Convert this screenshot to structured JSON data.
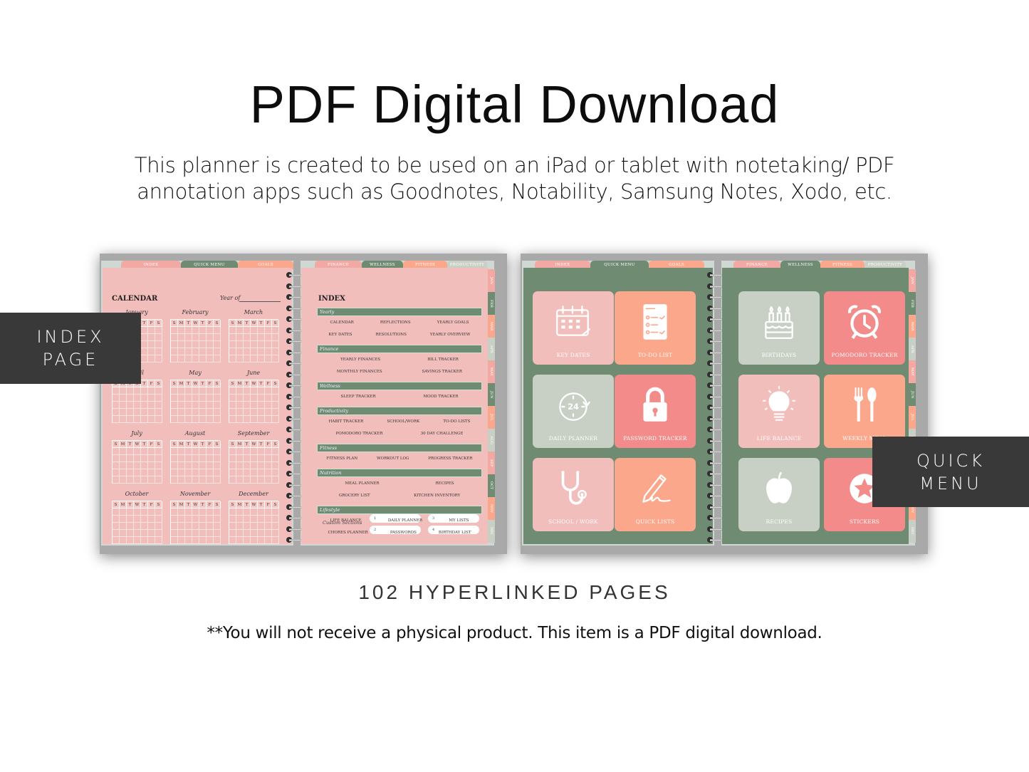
{
  "header": {
    "title": "PDF Digital Download",
    "subtitle_line1": "This planner is created to be used on an iPad or tablet with notetaking/ PDF",
    "subtitle_line2": "annotation apps such as Goodnotes, Notability, Samsung Notes, Xodo, etc."
  },
  "overlays": {
    "index_line1": "INDEX",
    "index_line2": "PAGE",
    "quick_line1": "QUICK",
    "quick_line2": "MENU"
  },
  "footer": {
    "pages_count": "102 HYPERLINKED PAGES",
    "disclaimer": "**You will not receive a physical product. This item is a PDF digital download."
  },
  "colors": {
    "pink": "#f2bebb",
    "green": "#6f8c73",
    "salmon": "#fba78c",
    "sage": "#c8cfc5",
    "rose": "#f28b89",
    "overlay": "#3a3939"
  },
  "top_tabs_left": [
    {
      "label": "INDEX",
      "color": "pink"
    },
    {
      "label": "QUICK MENU",
      "color": "green"
    },
    {
      "label": "GOALS",
      "color": "salmon"
    }
  ],
  "top_tabs_right": [
    {
      "label": "FINANCE",
      "color": "pink"
    },
    {
      "label": "WELLNESS",
      "color": "green"
    },
    {
      "label": "FITNESS",
      "color": "salmon"
    },
    {
      "label": "PRODUCTIVITY",
      "color": "sage"
    }
  ],
  "month_tabs": [
    {
      "label": "JAN",
      "color": "pink"
    },
    {
      "label": "FEB",
      "color": "green"
    },
    {
      "label": "MAR",
      "color": "salmon"
    },
    {
      "label": "APR",
      "color": "sage"
    },
    {
      "label": "MAY",
      "color": "pink"
    },
    {
      "label": "JUN",
      "color": "green"
    },
    {
      "label": "JUL",
      "color": "salmon"
    },
    {
      "label": "AUG",
      "color": "sage"
    },
    {
      "label": "SEP",
      "color": "pink"
    },
    {
      "label": "OCT",
      "color": "green"
    },
    {
      "label": "NOV",
      "color": "salmon"
    },
    {
      "label": "DEC",
      "color": "sage"
    }
  ],
  "calendar": {
    "title": "CALENDAR",
    "year_of": "Year of",
    "weekdays": [
      "S",
      "M",
      "T",
      "W",
      "T",
      "F",
      "S"
    ],
    "months": [
      "January",
      "February",
      "March",
      "April",
      "May",
      "June",
      "July",
      "August",
      "September",
      "October",
      "November",
      "December"
    ]
  },
  "index": {
    "title": "INDEX",
    "sections": [
      {
        "name": "Yearly",
        "rows": [
          [
            "CALENDAR",
            "REFLECTIONS",
            "YEARLY GOALS"
          ],
          [
            "KEY DATES",
            "RESOLUTIONS",
            "YEARLY OVERVIEW"
          ]
        ]
      },
      {
        "name": "Finance",
        "rows": [
          [
            "YEARLY FINANCES",
            "BILL TRACKER"
          ],
          [
            "MONTHLY FINANCES",
            "SAVINGS TRACKER"
          ]
        ]
      },
      {
        "name": "Wellness",
        "rows": [
          [
            "SLEEP TRACKER",
            "MOOD TRACKER"
          ]
        ]
      },
      {
        "name": "Productivity",
        "rows": [
          [
            "HABIT TRACKER",
            "SCHOOL/WORK",
            "TO-DO LISTS"
          ],
          [
            "POMODORO TRACKER",
            "30 DAY CHALLENGE"
          ]
        ]
      },
      {
        "name": "Fitness",
        "rows": [
          [
            "FITNESS PLAN",
            "WORKOUT LOG",
            "PROGRESS TRACKER"
          ]
        ]
      },
      {
        "name": "Nutrition",
        "rows": [
          [
            "MEAL PLANNER",
            "RECIPES"
          ],
          [
            "GROCERY LIST",
            "KITCHEN INVENTORY"
          ]
        ]
      },
      {
        "name": "Lifestyle",
        "rows": [
          [
            "LIFE BALANCE",
            "DAILY PLANNER",
            "MY LISTS"
          ],
          [
            "CHORES PLANNER",
            "PASSWORDS",
            "BIRTHDAY LIST"
          ]
        ]
      }
    ],
    "custom_label": "Custom Sections",
    "custom_slots": [
      "1",
      "2",
      "3",
      "4"
    ]
  },
  "quick_menu": {
    "title": "QUICK MENU",
    "tiles": [
      {
        "label": "KEY DATES",
        "icon": "calendar-icon",
        "color": "pink"
      },
      {
        "label": "TO-DO LIST",
        "icon": "checklist-icon",
        "color": "salmon"
      },
      {
        "label": "BIRTHDAYS",
        "icon": "birthday-cake-icon",
        "color": "sage"
      },
      {
        "label": "POMODORO TRACKER",
        "icon": "alarm-clock-icon",
        "color": "rose"
      },
      {
        "label": "DAILY PLANNER",
        "icon": "24-hour-clock-icon",
        "color": "sage"
      },
      {
        "label": "PASSWORD TRACKER",
        "icon": "padlock-icon",
        "color": "rose"
      },
      {
        "label": "LIFE BALANCE",
        "icon": "lightbulb-icon",
        "color": "pink"
      },
      {
        "label": "WEEKLY MEAL",
        "icon": "fork-spoon-icon",
        "color": "salmon"
      },
      {
        "label": "SCHOOL / WORK",
        "icon": "stethoscope-icon",
        "color": "pink"
      },
      {
        "label": "QUICK LISTS",
        "icon": "pencil-signature-icon",
        "color": "salmon"
      },
      {
        "label": "RECIPES",
        "icon": "apple-icon",
        "color": "sage"
      },
      {
        "label": "STICKERS",
        "icon": "star-sticker-icon",
        "color": "rose"
      }
    ]
  }
}
